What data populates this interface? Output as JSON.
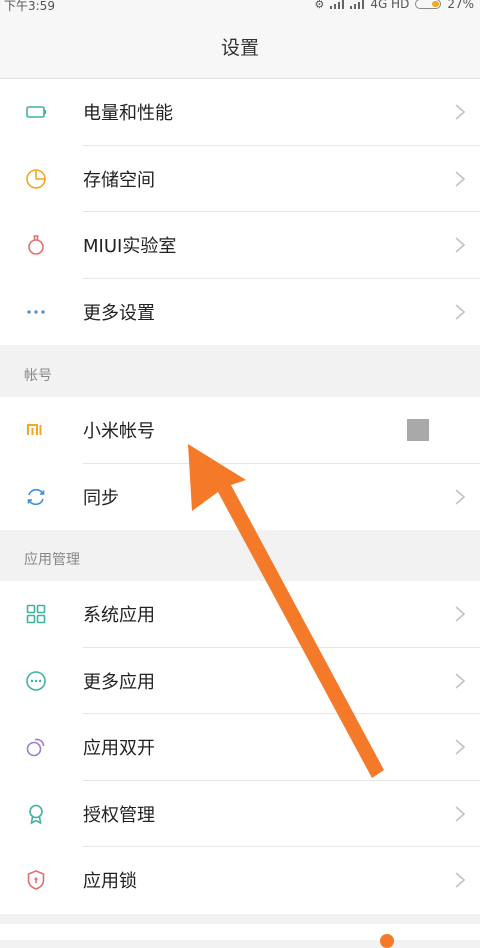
{
  "status": {
    "time": "下午3:59",
    "network": "4G HD",
    "battery": "27%"
  },
  "title": "设置",
  "groups": [
    {
      "items": [
        {
          "label": "电量和性能",
          "icon": "battery-icon"
        },
        {
          "label": "存储空间",
          "icon": "storage-pie-icon"
        },
        {
          "label": "MIUI实验室",
          "icon": "flask-icon"
        },
        {
          "label": "更多设置",
          "icon": "more-dots-icon"
        }
      ]
    },
    {
      "header": "帐号",
      "items": [
        {
          "label": "小米帐号",
          "icon": "mi-logo-icon"
        },
        {
          "label": "同步",
          "icon": "sync-icon"
        }
      ]
    },
    {
      "header": "应用管理",
      "items": [
        {
          "label": "系统应用",
          "icon": "grid-apps-icon"
        },
        {
          "label": "更多应用",
          "icon": "more-apps-icon"
        },
        {
          "label": "应用双开",
          "icon": "dual-apps-icon"
        },
        {
          "label": "授权管理",
          "icon": "award-icon"
        },
        {
          "label": "应用锁",
          "icon": "shield-lock-icon"
        }
      ]
    }
  ],
  "colors": {
    "teal": "#3fb3a0",
    "orange": "#f5a623",
    "pink": "#e46f6f",
    "blue": "#3d8fd6",
    "arrow": "#f47a2a"
  }
}
